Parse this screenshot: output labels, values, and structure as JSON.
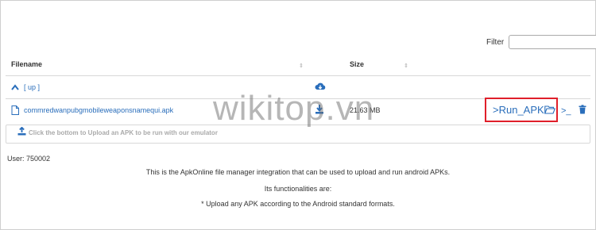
{
  "filter": {
    "label": "Filter",
    "value": ""
  },
  "table": {
    "headers": {
      "filename": "Filename",
      "size": "Size"
    },
    "up_row": {
      "label": "[ up ]"
    },
    "file_row": {
      "name": "commredwanpubgmobileweaponsnamequi.apk",
      "size": "21.63 MB"
    }
  },
  "actions": {
    "run_apk": ">Run_APK",
    "terminal": ">_"
  },
  "upload": {
    "hint": "Click the bottom to Upload an APK to be run with our emulator"
  },
  "user": {
    "line": "User: 750002"
  },
  "info": {
    "line1": "This is the ApkOnline file manager integration that can be used to upload and run android APKs.",
    "line2": "Its functionalities are:",
    "line3": "* Upload any APK according to the Android standard formats."
  },
  "watermark": "wikitop.vn",
  "colors": {
    "link": "#2a6ebb",
    "highlight": "#e01f2a"
  },
  "icons": [
    "chevron-up-icon",
    "cloud-download-icon",
    "file-icon",
    "download-icon",
    "folder-open-icon",
    "terminal-icon",
    "trash-icon",
    "upload-icon",
    "sort-icon"
  ]
}
